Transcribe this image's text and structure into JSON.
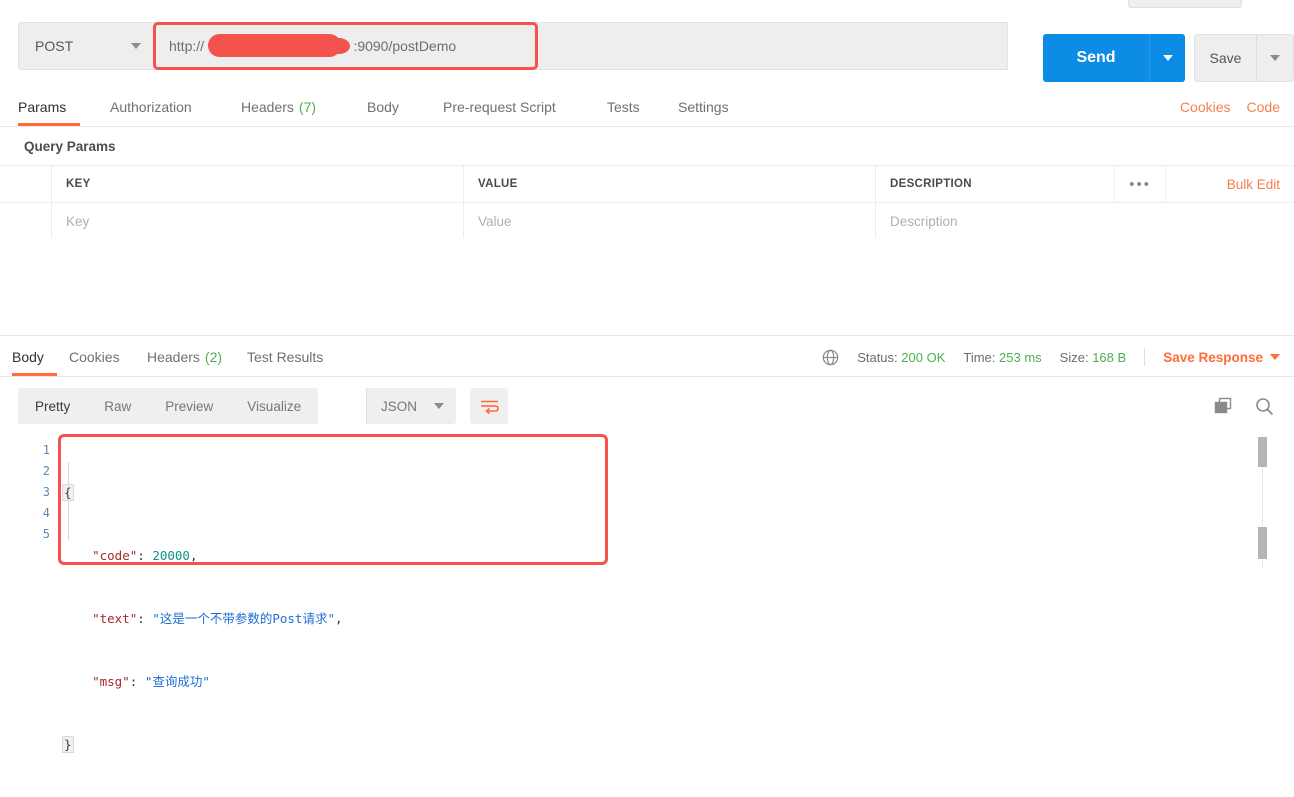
{
  "request_bar": {
    "method": "POST",
    "url_prefix": "http://",
    "url_suffix": ":9090/postDemo",
    "send_label": "Send",
    "save_label": "Save"
  },
  "request_tabs": [
    {
      "label": "Params",
      "badge": "",
      "active": true
    },
    {
      "label": "Authorization",
      "badge": "",
      "active": false
    },
    {
      "label": "Headers",
      "badge": "(7)",
      "active": false
    },
    {
      "label": "Body",
      "badge": "",
      "active": false
    },
    {
      "label": "Pre-request Script",
      "badge": "",
      "active": false
    },
    {
      "label": "Tests",
      "badge": "",
      "active": false
    },
    {
      "label": "Settings",
      "badge": "",
      "active": false
    }
  ],
  "request_tab_links": {
    "cookies": "Cookies",
    "code": "Code"
  },
  "query_params": {
    "section_title": "Query Params",
    "headers": [
      "KEY",
      "VALUE",
      "DESCRIPTION"
    ],
    "more_dots": "•••",
    "bulk_edit": "Bulk Edit",
    "placeholders": [
      "Key",
      "Value",
      "Description"
    ]
  },
  "response_tabs": [
    {
      "label": "Body",
      "badge": "",
      "active": true
    },
    {
      "label": "Cookies",
      "badge": "",
      "active": false
    },
    {
      "label": "Headers",
      "badge": "(2)",
      "active": false
    },
    {
      "label": "Test Results",
      "badge": "",
      "active": false
    }
  ],
  "response_status": {
    "status_label": "Status:",
    "status_value": "200 OK",
    "time_label": "Time:",
    "time_value": "253 ms",
    "size_label": "Size:",
    "size_value": "168 B",
    "save_response": "Save Response"
  },
  "body_toolbar": {
    "views": [
      "Pretty",
      "Raw",
      "Preview",
      "Visualize"
    ],
    "active_view": "Pretty",
    "format": "JSON"
  },
  "response_body": {
    "line_numbers": [
      "1",
      "2",
      "3",
      "4",
      "5"
    ],
    "json": {
      "code": 20000,
      "text": "这是一个不带参数的Post请求",
      "msg": "查询成功"
    },
    "lines": [
      {
        "num": "1",
        "text": "{"
      },
      {
        "num": "2",
        "text": "    \"code\": 20000,"
      },
      {
        "num": "3",
        "text": "    \"text\": \"这是一个不带参数的Post请求\","
      },
      {
        "num": "4",
        "text": "    \"msg\": \"查询成功\""
      },
      {
        "num": "5",
        "text": "}"
      }
    ]
  },
  "colors": {
    "accent_orange": "#ff6c37",
    "send_blue": "#0d8ce6",
    "status_green": "#4caf50",
    "annotation_red": "#f4524c",
    "json_key": "#a52a2a",
    "json_string": "#1f6fd0",
    "json_number": "#0d9488"
  }
}
